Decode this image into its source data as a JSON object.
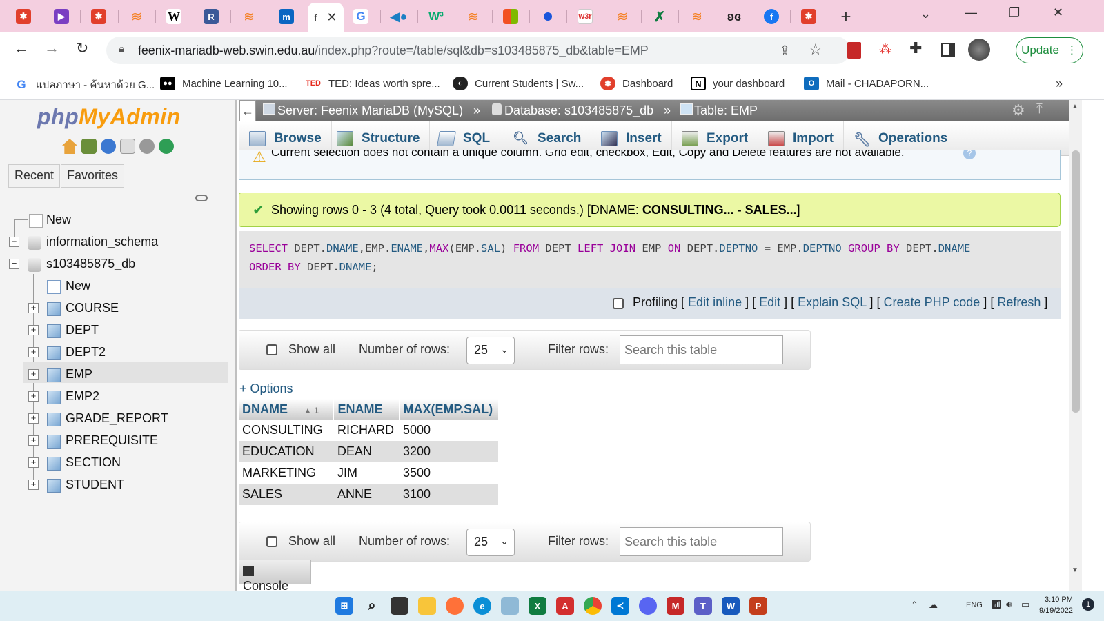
{
  "browser": {
    "active_tab_label": "f",
    "url_host": "feenix-mariadb-web.swin.edu.au",
    "url_path": "/index.php?route=/table/sql&db=s103485875_db&table=EMP",
    "update_label": "Update",
    "bookmarks": [
      {
        "label": "แปลภาษา - ค้นหาด้วย G...",
        "icon": "google-icon",
        "color": "#4285f4"
      },
      {
        "label": "Machine Learning 10...",
        "icon": "medium-icon",
        "color": "#000000"
      },
      {
        "label": "TED: Ideas worth spre...",
        "icon": "ted-icon",
        "color": "#e62b1e",
        "icon_text": "TED"
      },
      {
        "label": "Current Students | Sw...",
        "icon": "globe-icon",
        "color": "#222222"
      },
      {
        "label": "Dashboard",
        "icon": "canvas-icon",
        "color": "#e13f2c"
      },
      {
        "label": "your dashboard",
        "icon": "notion-icon",
        "color": "#000000",
        "icon_text": "N"
      },
      {
        "label": "Mail - CHADAPORN...",
        "icon": "outlook-icon",
        "color": "#0f6cbd",
        "icon_text": "O"
      }
    ]
  },
  "sidebar": {
    "logo_php": "php",
    "logo_myadmin": "MyAdmin",
    "recent_label": "Recent",
    "favorites_label": "Favorites",
    "tree": [
      {
        "label": "New"
      },
      {
        "label": "information_schema"
      },
      {
        "label": "s103485875_db"
      },
      {
        "label": "New"
      },
      {
        "label": "COURSE"
      },
      {
        "label": "DEPT"
      },
      {
        "label": "DEPT2"
      },
      {
        "label": "EMP"
      },
      {
        "label": "EMP2"
      },
      {
        "label": "GRADE_REPORT"
      },
      {
        "label": "PREREQUISITE"
      },
      {
        "label": "SECTION"
      },
      {
        "label": "STUDENT"
      }
    ]
  },
  "breadcrumb": {
    "server": "Server: Feenix MariaDB (MySQL)",
    "database": "Database: s103485875_db",
    "table": "Table: EMP",
    "sep": "»"
  },
  "tabs": [
    {
      "label": "Browse",
      "icon": "browse-icon"
    },
    {
      "label": "Structure",
      "icon": "structure-icon"
    },
    {
      "label": "SQL",
      "icon": "sql-icon"
    },
    {
      "label": "Search",
      "icon": "search-icon"
    },
    {
      "label": "Insert",
      "icon": "insert-icon"
    },
    {
      "label": "Export",
      "icon": "export-icon"
    },
    {
      "label": "Import",
      "icon": "import-icon"
    },
    {
      "label": "Operations",
      "icon": "operations-icon"
    }
  ],
  "warning_text": "Current selection does not contain a unique column. Grid edit, checkbox, Edit, Copy and Delete features are not available.",
  "success": {
    "prefix": "Showing rows 0 - 3 (4 total, Query took 0.0011 seconds.) [DNAME: ",
    "range": "CONSULTING... - SALES...",
    "suffix": "]"
  },
  "sql": {
    "line1": [
      "SELECT",
      " DEPT.",
      "DNAME",
      ",EMP.",
      "ENAME",
      ",",
      "MAX",
      "(EMP.",
      "SAL",
      ") ",
      "FROM",
      " DEPT ",
      "LEFT",
      " ",
      "JOIN",
      " EMP ",
      "ON",
      " DEPT.",
      "DEPTNO",
      " = EMP.",
      "DEPTNO",
      " ",
      "GROUP BY",
      " DEPT.",
      "DNAME"
    ],
    "line2": [
      "ORDER BY",
      " DEPT.",
      "DNAME",
      ";"
    ]
  },
  "sqlbar": {
    "profiling": "Profiling",
    "links": [
      "Edit inline",
      "Edit",
      "Explain SQL",
      "Create PHP code",
      "Refresh"
    ]
  },
  "navbar": {
    "show_all": "Show all",
    "num_rows_label": "Number of rows:",
    "num_rows_value": "25",
    "filter_label": "Filter rows:",
    "filter_placeholder": "Search this table"
  },
  "options_label": "+ Options",
  "results": {
    "columns": [
      "DNAME",
      "ENAME",
      "MAX(EMP.SAL)"
    ],
    "sort_indicator": "▲ 1",
    "rows": [
      [
        "CONSULTING",
        "RICHARD",
        "5000"
      ],
      [
        "EDUCATION",
        "DEAN",
        "3200"
      ],
      [
        "MARKETING",
        "JIM",
        "3500"
      ],
      [
        "SALES",
        "ANNE",
        "3100"
      ]
    ]
  },
  "console_label": "Console",
  "taskbar": {
    "lang": "ENG",
    "time": "3:10 PM",
    "date": "9/19/2022",
    "notifications": "1"
  }
}
